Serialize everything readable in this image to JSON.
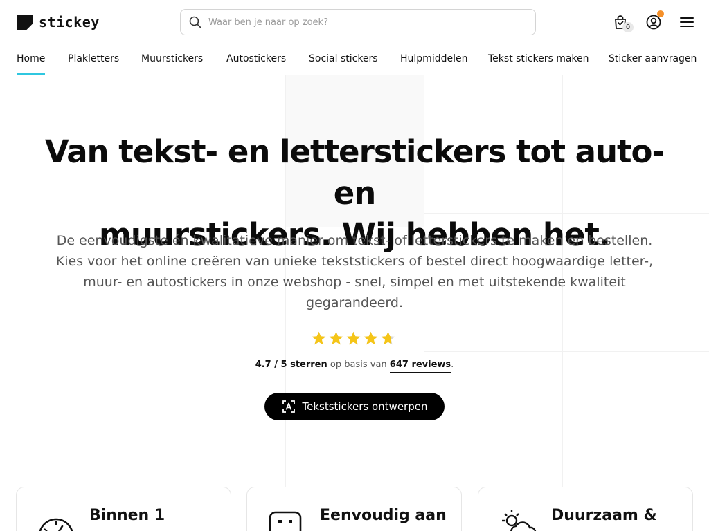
{
  "header": {
    "logo_text": "stickey",
    "search_placeholder": "Waar ben je naar op zoek?",
    "cart_count": "0"
  },
  "nav": {
    "items": [
      {
        "label": "Home"
      },
      {
        "label": "Plakletters"
      },
      {
        "label": "Muurstickers"
      },
      {
        "label": "Autostickers"
      },
      {
        "label": "Social stickers"
      },
      {
        "label": "Hulpmiddelen"
      },
      {
        "label": "Tekst stickers maken"
      },
      {
        "label": "Sticker aanvragen"
      }
    ],
    "active_index": 0
  },
  "hero": {
    "title_line1": "Van tekst- en letterstickers tot auto- en",
    "title_line2": "muurstickers. Wij hebben het.",
    "subtitle": "De eenvoudigste én kwalitatieve manier om tekst- of letterstickers te maken en bestellen. Kies voor het online creëren van unieke tekststickers of bestel direct hoogwaardige letter-, muur- en autostickers in onze webshop - snel, simpel en met uitstekende kwaliteit gegarandeerd."
  },
  "rating": {
    "stars": 4.7,
    "score_text": "4.7 / 5 sterren",
    "middle_text": " op basis van ",
    "reviews_text": "647 reviews",
    "end_text": "."
  },
  "cta": {
    "label": "Tekststickers ontwerpen"
  },
  "cards": [
    {
      "title": "Binnen 1",
      "icon": "speedometer-icon"
    },
    {
      "title": "Eenvoudig aan",
      "icon": "smiley-sticker-icon"
    },
    {
      "title": "Duurzaam &",
      "icon": "sun-cloud-icon"
    }
  ],
  "colors": {
    "accent": "#2fc7e0",
    "star": "#f5c518",
    "notification": "#f5902a",
    "cta_bg": "#000000"
  }
}
